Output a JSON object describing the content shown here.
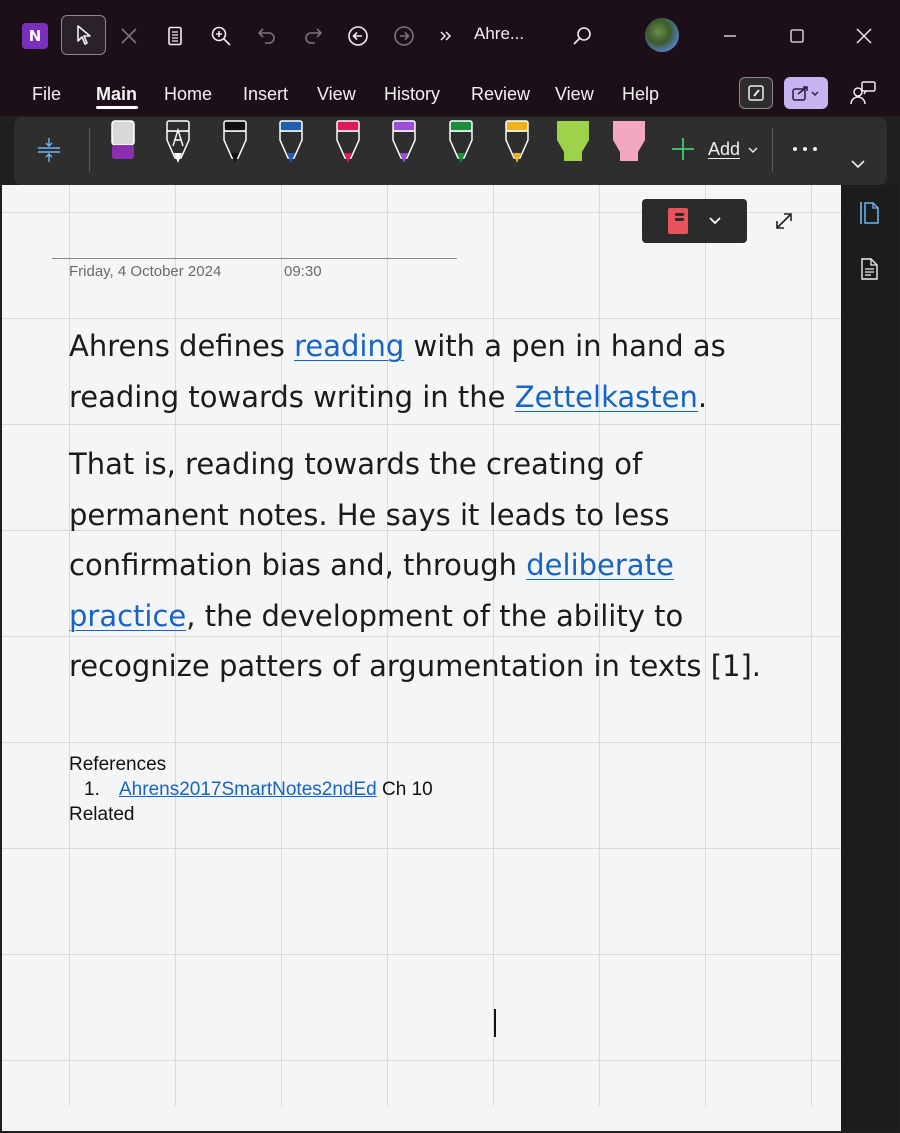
{
  "app": {
    "icon_letter": "N",
    "title": "Ahre...",
    "accent": "#7b2fbd"
  },
  "titlebar_icons": [
    "select-cursor-icon",
    "close-x-icon",
    "immersive-reader-icon",
    "zoom-in-icon",
    "undo-icon",
    "redo-icon",
    "back-icon",
    "forward-icon",
    "overflow-icon",
    "search-icon",
    "avatar",
    "minimize-icon",
    "maximize-icon",
    "close-window-icon"
  ],
  "menu": {
    "items": [
      "File",
      "Main",
      "Home",
      "Insert",
      "View",
      "History",
      "Review",
      "View",
      "Help"
    ],
    "active": "Main"
  },
  "ribbon": {
    "add_label": "Add",
    "pens": [
      {
        "name": "eraser",
        "color": "#8a2fb0"
      },
      {
        "name": "ink-to-text-pen",
        "color": "#ffffff"
      },
      {
        "name": "black-pen",
        "color": "#111111"
      },
      {
        "name": "blue-pen",
        "color": "#1f5fae"
      },
      {
        "name": "pink-pen",
        "color": "#e0195c"
      },
      {
        "name": "purple-pen",
        "color": "#9b4fd6"
      },
      {
        "name": "green-pen",
        "color": "#1a8f3c"
      },
      {
        "name": "yellow-pen",
        "color": "#f0b21a"
      },
      {
        "name": "green-highlighter",
        "color": "#9ed24b"
      },
      {
        "name": "pink-highlighter",
        "color": "#f4a7c3"
      }
    ]
  },
  "page": {
    "date": "Friday, 4 October 2024",
    "time": "09:30",
    "notebook_color": "#e8535b",
    "paragraph1": {
      "pre": "Ahrens defines ",
      "link1": "reading",
      "mid": " with a pen in hand as reading towards writing in the ",
      "link2": "Zettelkasten",
      "post": "."
    },
    "paragraph2": {
      "pre": "That is, reading towards the creating of permanent notes. He says it leads to less confirmation bias and, through ",
      "link": "deliberate practice",
      "post": ", the development of the ability to recognize patters of argumentation in texts [1]."
    },
    "references_heading": "References",
    "reference_number": "1.",
    "reference_link": "Ahrens2017SmartNotes2ndEd",
    "reference_suffix": " Ch 10",
    "related_heading": "Related"
  }
}
